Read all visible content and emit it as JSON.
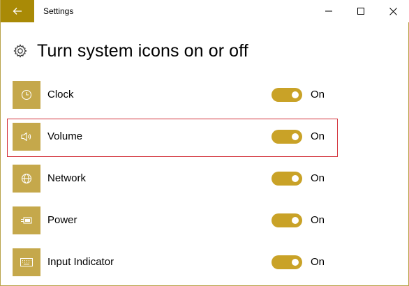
{
  "window": {
    "title": "Settings"
  },
  "header": {
    "title": "Turn system icons on or off",
    "icon": "gear-icon"
  },
  "items": [
    {
      "label": "Clock",
      "icon": "clock-icon",
      "state": "On",
      "on": true
    },
    {
      "label": "Volume",
      "icon": "volume-icon",
      "state": "On",
      "on": true
    },
    {
      "label": "Network",
      "icon": "globe-icon",
      "state": "On",
      "on": true
    },
    {
      "label": "Power",
      "icon": "power-plug-icon",
      "state": "On",
      "on": true
    },
    {
      "label": "Input Indicator",
      "icon": "keyboard-icon",
      "state": "On",
      "on": true
    }
  ],
  "colors": {
    "accent": "#a98a06",
    "tile": "#c5a84b",
    "toggle_on": "#c9a227",
    "highlight": "#d3323b"
  }
}
